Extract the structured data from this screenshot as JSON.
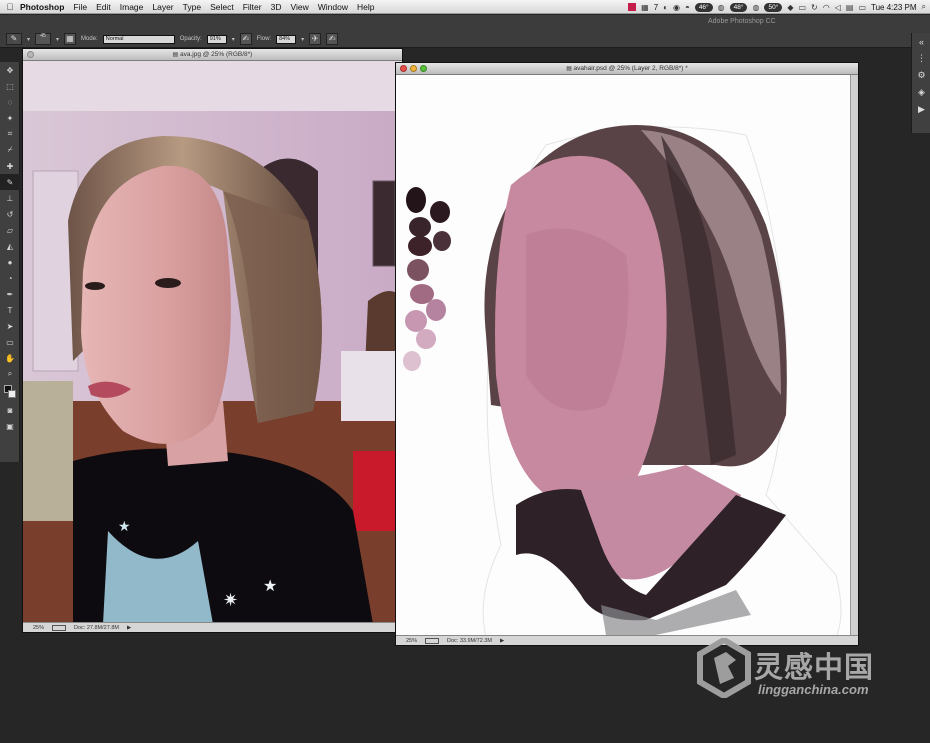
{
  "menubar": {
    "apple_glyph": "",
    "app_name": "Photoshop",
    "items": [
      "File",
      "Edit",
      "Image",
      "Layer",
      "Type",
      "Select",
      "Filter",
      "3D",
      "View",
      "Window",
      "Help"
    ],
    "status_number": "7",
    "temps": [
      "46°",
      "48°",
      "50°"
    ],
    "clock": "Tue 4:23 PM"
  },
  "app_title": "Adobe Photoshop CC",
  "options": {
    "brush_size": "45",
    "mode_label": "Mode:",
    "mode_value": "Normal",
    "opacity_label": "Opacity:",
    "opacity_value": "91%",
    "flow_label": "Flow:",
    "flow_value": "84%"
  },
  "doc1": {
    "title": "ava.jpg @ 25% (RGB/8*)",
    "zoom": "25%",
    "doc_size": "Doc: 27.8M/27.8M"
  },
  "doc2": {
    "title": "avahair.psd @ 25% (Layer 2, RGB/8*)",
    "title_modified": "*",
    "zoom": "25%",
    "doc_size": "Doc: 33.9M/72.3M"
  },
  "watermark": {
    "chinese": "灵感中国",
    "english": "lingganchina.com"
  },
  "colors": {
    "ui_background": "#262626",
    "panel": "#3c3c3c",
    "foreground": "#111111",
    "background_color": "#eeeeee",
    "close": "#e74f4a",
    "minimize": "#f0b43a",
    "zoom": "#56c03b"
  }
}
